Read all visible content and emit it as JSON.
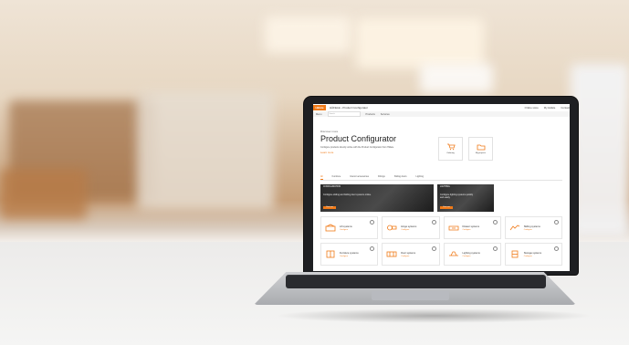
{
  "screen": {
    "brand": "Häfele",
    "breadcrumb": "HÄFELE › Product Configurator",
    "util_links": [
      "Online store",
      "My Häfele",
      "Contact"
    ],
    "subbar_items": [
      "Menu",
      "Products",
      "Services"
    ],
    "search_placeholder": "Search",
    "kicker": "Discover more",
    "title": "Product Configurator",
    "description": "Configure products directly online with the Product Configurator from Häfele.",
    "link": "Learn more",
    "quick_links": [
      {
        "label": "Ordering",
        "icon": "cart-icon"
      },
      {
        "label": "My projects",
        "icon": "folder-icon"
      }
    ],
    "tabs": [
      {
        "label": "All",
        "active": true
      },
      {
        "label": "Furniture"
      },
      {
        "label": "Interior accessories"
      },
      {
        "label": "Fittings"
      },
      {
        "label": "Sliding doors"
      },
      {
        "label": "Lighting"
      }
    ],
    "banners": [
      {
        "tag": "CONFIGURATION",
        "text": "Configure sliding and folding door systems online.",
        "button": "Start now"
      },
      {
        "tag": "LIGHTING",
        "text": "Configure lighting systems quickly and easily.",
        "button": "Start now"
      }
    ],
    "tiles": [
      {
        "title": "Lift systems",
        "link": "Configure",
        "icon": "lift-icon"
      },
      {
        "title": "Hinge systems",
        "link": "Configure",
        "icon": "hinge-icon"
      },
      {
        "title": "Drawer systems",
        "link": "Configure",
        "icon": "drawer-icon"
      },
      {
        "title": "Sliding systems",
        "link": "Configure",
        "icon": "slide-icon"
      },
      {
        "title": "Furniture systems",
        "link": "Configure",
        "icon": "furniture-icon"
      },
      {
        "title": "Door systems",
        "link": "Configure",
        "icon": "door-icon"
      },
      {
        "title": "Lighting systems",
        "link": "Configure",
        "icon": "light-icon"
      },
      {
        "title": "Storage systems",
        "link": "Configure",
        "icon": "storage-icon"
      }
    ]
  },
  "colors": {
    "accent": "#f07a18",
    "screen_bg": "#ffffff",
    "laptop": "#1e1f22"
  }
}
